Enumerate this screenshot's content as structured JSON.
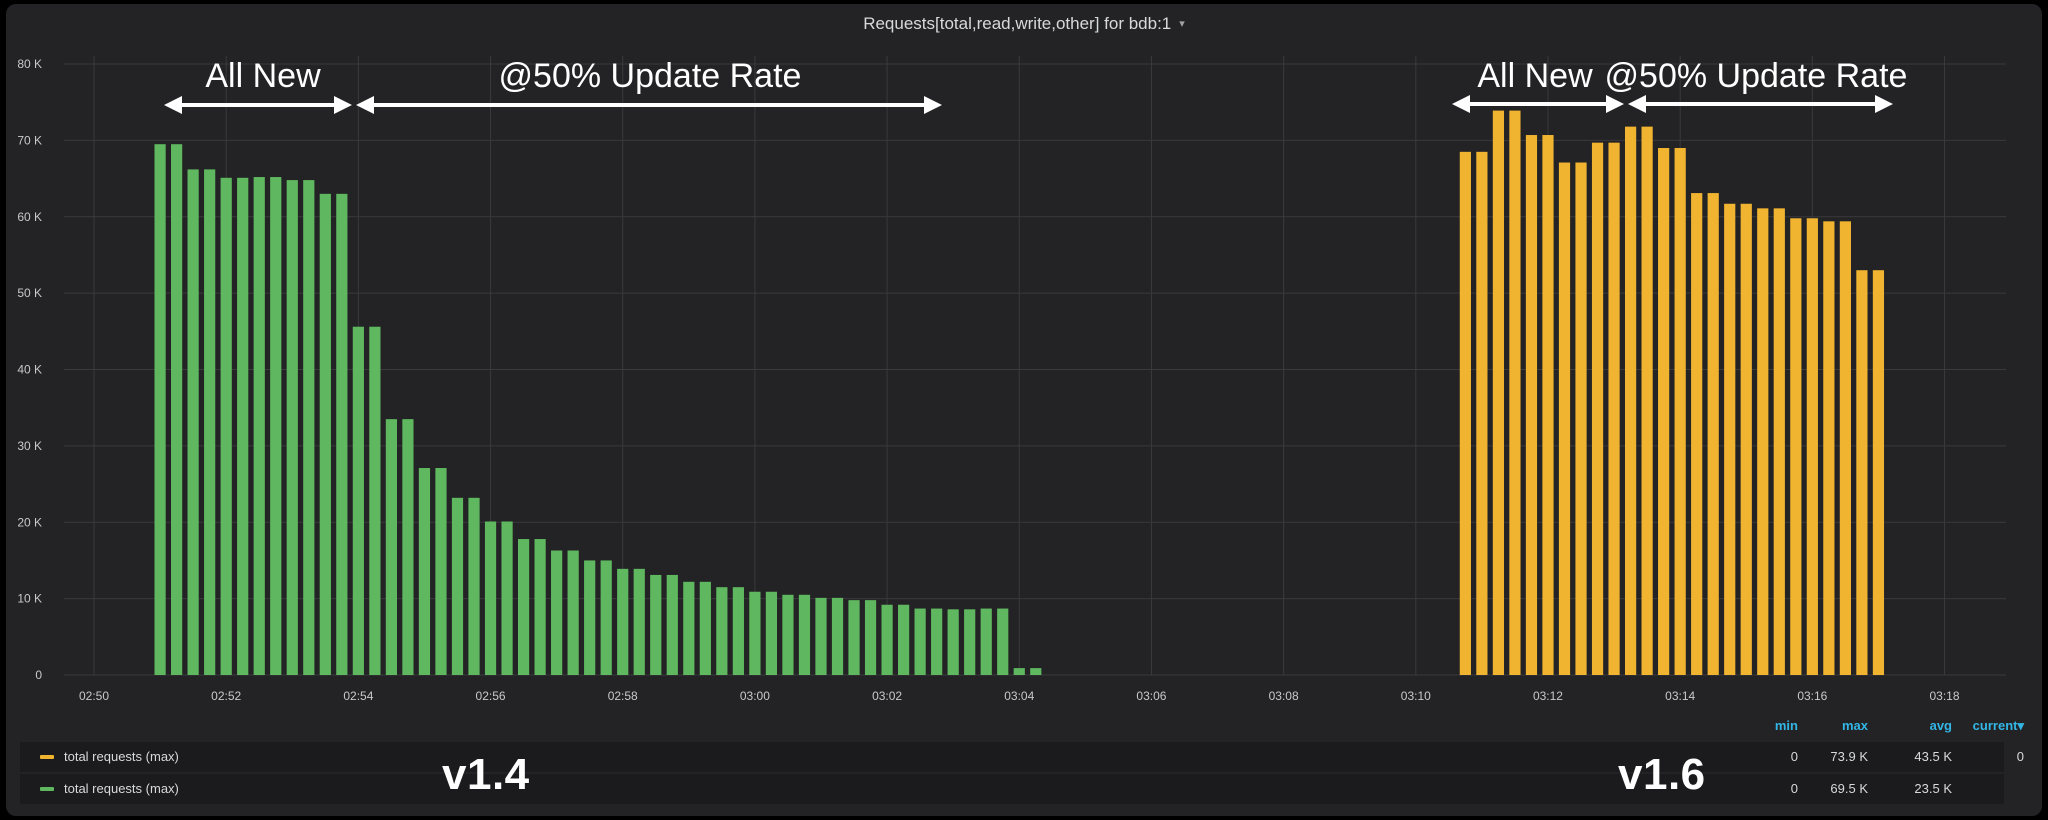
{
  "panel": {
    "title": "Requests[total,read,write,other] for bdb:1",
    "caret": "▾"
  },
  "colors": {
    "background": "#232325",
    "grid": "#3a3a3d",
    "tick_text": "#c8c9ca",
    "v14": "#5fb85f",
    "v16": "#f1b431",
    "annotation": "#ffffff",
    "legend_header": "#33b5e5"
  },
  "annotations": {
    "left_all_new": "All New",
    "left_update_rate": "@50% Update Rate",
    "right_all_new": "All New",
    "right_update_rate": "@50% Update Rate",
    "version_left": "v1.4",
    "version_right": "v1.6"
  },
  "legend": {
    "headers": {
      "min": "min",
      "max": "max",
      "avg": "avg",
      "current": "current▾"
    },
    "rows": [
      {
        "label": "total requests (max)",
        "color": "#f1b431",
        "min": "0",
        "max": "73.9 K",
        "avg": "43.5 K",
        "current": "0"
      },
      {
        "label": "total requests (max)",
        "color": "#5fb85f",
        "min": "0",
        "max": "69.5 K",
        "avg": "23.5 K",
        "current": ""
      }
    ]
  },
  "chart_data": {
    "type": "bar",
    "title": "Requests[total,read,write,other] for bdb:1",
    "xlabel": "",
    "ylabel": "",
    "ylim": [
      0,
      80000
    ],
    "yticks": [
      "0",
      "10 K",
      "20 K",
      "30 K",
      "40 K",
      "50 K",
      "60 K",
      "70 K",
      "80 K"
    ],
    "xticks": [
      "02:50",
      "02:52",
      "02:54",
      "02:56",
      "02:58",
      "03:00",
      "03:02",
      "03:04",
      "03:06",
      "03:08",
      "03:10",
      "03:12",
      "03:14",
      "03:16",
      "03:18"
    ],
    "grid": true,
    "legend_position": "bottom",
    "series": [
      {
        "version": "v1.4",
        "color": "#5fb85f",
        "x": [
          "02:51:00",
          "02:51:15",
          "02:51:30",
          "02:51:45",
          "02:52:00",
          "02:52:15",
          "02:52:30",
          "02:52:45",
          "02:53:00",
          "02:53:15",
          "02:53:30",
          "02:53:45",
          "02:54:00",
          "02:54:15",
          "02:54:30",
          "02:54:45",
          "02:55:00",
          "02:55:15",
          "02:55:30",
          "02:55:45",
          "02:56:00",
          "02:56:15",
          "02:56:30",
          "02:56:45",
          "02:57:00",
          "02:57:15",
          "02:57:30",
          "02:57:45",
          "02:58:00",
          "02:58:15",
          "02:58:30",
          "02:58:45",
          "02:59:00",
          "02:59:15",
          "02:59:30",
          "02:59:45",
          "03:00:00",
          "03:00:15",
          "03:00:30",
          "03:00:45",
          "03:01:00",
          "03:01:15",
          "03:01:30",
          "03:01:45",
          "03:02:00",
          "03:02:15",
          "03:02:30",
          "03:02:45",
          "03:03:00",
          "03:03:15",
          "03:03:30",
          "03:03:45",
          "03:04:00",
          "03:04:15"
        ],
        "values": [
          69500,
          69500,
          66200,
          66200,
          65100,
          65100,
          65200,
          65200,
          64800,
          64800,
          63000,
          63000,
          45600,
          45600,
          33500,
          33500,
          27100,
          27100,
          23200,
          23200,
          20100,
          20100,
          17800,
          17800,
          16300,
          16300,
          15000,
          15000,
          13900,
          13900,
          13100,
          13100,
          12200,
          12200,
          11500,
          11500,
          10900,
          10900,
          10500,
          10500,
          10100,
          10100,
          9800,
          9800,
          9200,
          9200,
          8700,
          8700,
          8600,
          8600,
          8700,
          8700,
          900,
          900
        ]
      },
      {
        "version": "v1.6",
        "color": "#f1b431",
        "x": [
          "03:10:45",
          "03:11:00",
          "03:11:15",
          "03:11:30",
          "03:11:45",
          "03:12:00",
          "03:12:15",
          "03:12:30",
          "03:12:45",
          "03:13:00",
          "03:13:15",
          "03:13:30",
          "03:13:45",
          "03:14:00",
          "03:14:15",
          "03:14:30",
          "03:14:45",
          "03:15:00",
          "03:15:15",
          "03:15:30",
          "03:15:45",
          "03:16:00",
          "03:16:15",
          "03:16:30",
          "03:16:45",
          "03:17:00"
        ],
        "values": [
          68500,
          68500,
          73900,
          73900,
          70700,
          70700,
          67100,
          67100,
          69700,
          69700,
          71800,
          71800,
          69000,
          69000,
          63100,
          63100,
          61700,
          61700,
          61100,
          61100,
          59800,
          59800,
          59400,
          59400,
          53000,
          53000
        ]
      }
    ]
  }
}
